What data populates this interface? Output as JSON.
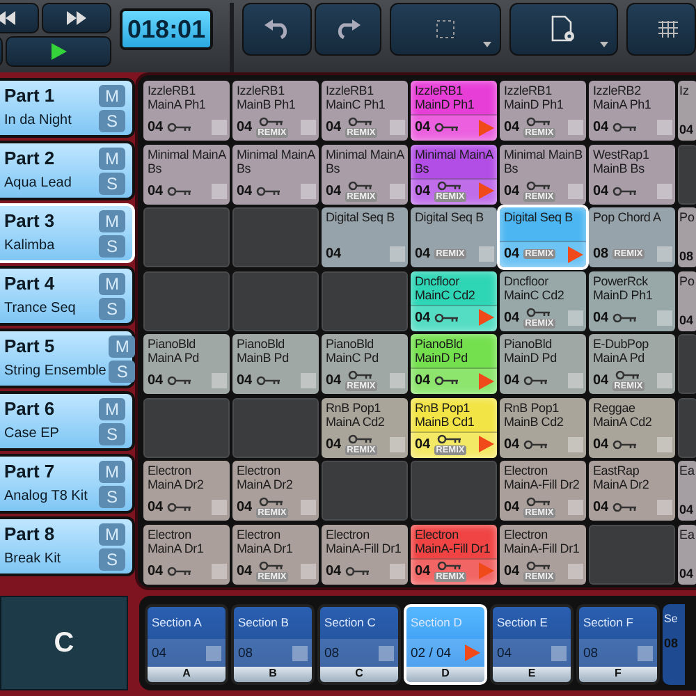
{
  "transport": {
    "time": "018:01"
  },
  "parts": [
    {
      "name": "Part 1",
      "sound": "In da Night",
      "mute": "M",
      "solo": "S",
      "selected": false
    },
    {
      "name": "Part 2",
      "sound": "Aqua Lead",
      "mute": "M",
      "solo": "S",
      "selected": false
    },
    {
      "name": "Part 3",
      "sound": "Kalimba",
      "mute": "M",
      "solo": "S",
      "selected": true
    },
    {
      "name": "Part 4",
      "sound": "Trance Seq",
      "mute": "M",
      "solo": "S",
      "selected": false
    },
    {
      "name": "Part 5",
      "sound": "String Ensemble",
      "mute": "M",
      "solo": "S",
      "selected": false
    },
    {
      "name": "Part 6",
      "sound": "Case EP",
      "mute": "M",
      "solo": "S",
      "selected": false
    },
    {
      "name": "Part 7",
      "sound": "Analog T8 Kit",
      "mute": "M",
      "solo": "S",
      "selected": false
    },
    {
      "name": "Part 8",
      "sound": "Break Kit",
      "mute": "M",
      "solo": "S",
      "selected": false
    }
  ],
  "grid": [
    [
      {
        "kind": "clip",
        "name": "IzzleRB1 MainA Ph1",
        "count": "04",
        "key": true,
        "playing": false,
        "selected": false,
        "color": "#a99ea8"
      },
      {
        "kind": "clip",
        "name": "IzzleRB1 MainB Ph1",
        "count": "04",
        "key": true,
        "badge": "REMIX",
        "playing": false,
        "selected": false,
        "color": "#a99ea8"
      },
      {
        "kind": "clip",
        "name": "IzzleRB1 MainC Ph1",
        "count": "04",
        "key": true,
        "badge": "REMIX",
        "playing": false,
        "selected": false,
        "color": "#a99ea8"
      },
      {
        "kind": "clip",
        "name": "IzzleRB1 MainD Ph1",
        "count": "04",
        "key": true,
        "playing": true,
        "selected": false,
        "color": "#e83ed8"
      },
      {
        "kind": "clip",
        "name": "IzzleRB1 MainD Ph1",
        "count": "04",
        "key": true,
        "badge": "REMIX",
        "playing": false,
        "selected": false,
        "color": "#a99ea8"
      },
      {
        "kind": "clip",
        "name": "IzzleRB2 MainA Ph1",
        "count": "04",
        "key": true,
        "playing": false,
        "selected": false,
        "color": "#a99ea8"
      },
      {
        "kind": "partial",
        "name": "Iz",
        "count": "04"
      }
    ],
    [
      {
        "kind": "clip",
        "name": "Minimal MainA Bs",
        "count": "04",
        "key": true,
        "playing": false,
        "selected": false,
        "color": "#a99ea8"
      },
      {
        "kind": "clip",
        "name": "Minimal MainA Bs",
        "count": "04",
        "key": true,
        "playing": false,
        "selected": false,
        "color": "#a99ea8"
      },
      {
        "kind": "clip",
        "name": "Minimal MainA Bs",
        "count": "04",
        "key": true,
        "badge": "REMIX",
        "playing": false,
        "selected": false,
        "color": "#a99ea8"
      },
      {
        "kind": "clip",
        "name": "Minimal MainA Bs",
        "count": "04",
        "key": true,
        "badge": "REMIX",
        "playing": true,
        "selected": false,
        "color": "#b24ee6"
      },
      {
        "kind": "clip",
        "name": "Minimal MainB Bs",
        "count": "04",
        "key": true,
        "badge": "REMIX",
        "playing": false,
        "selected": false,
        "color": "#a99ea8"
      },
      {
        "kind": "clip",
        "name": "WestRap1 MainB Bs",
        "count": "04",
        "key": true,
        "playing": false,
        "selected": false,
        "color": "#a99ea8"
      },
      {
        "kind": "empty"
      }
    ],
    [
      {
        "kind": "empty"
      },
      {
        "kind": "empty"
      },
      {
        "kind": "clip",
        "name": "Digital Seq B",
        "count": "04",
        "key": false,
        "playing": false,
        "selected": false,
        "color": "#97a3aa"
      },
      {
        "kind": "clip",
        "name": "Digital Seq B",
        "count": "04",
        "key": false,
        "badge": "REMIX",
        "playing": false,
        "selected": false,
        "color": "#97a3aa"
      },
      {
        "kind": "clip",
        "name": "Digital Seq B",
        "count": "04",
        "key": false,
        "badge": "REMIX",
        "playing": true,
        "selected": true,
        "color": "#4cb6f2"
      },
      {
        "kind": "clip",
        "name": "Pop Chord A",
        "count": "08",
        "key": false,
        "badge": "REMIX",
        "playing": false,
        "selected": false,
        "color": "#97a3aa"
      },
      {
        "kind": "partial",
        "name": "Po",
        "count": "08"
      }
    ],
    [
      {
        "kind": "empty"
      },
      {
        "kind": "empty"
      },
      {
        "kind": "empty"
      },
      {
        "kind": "clip",
        "name": "Dncfloor MainC Cd2",
        "count": "04",
        "key": true,
        "playing": true,
        "selected": false,
        "color": "#2fd6b6"
      },
      {
        "kind": "clip",
        "name": "Dncfloor MainC Cd2",
        "count": "04",
        "key": true,
        "badge": "REMIX",
        "playing": false,
        "selected": false,
        "color": "#98a8a8"
      },
      {
        "kind": "clip",
        "name": "PowerRck MainD Ph1",
        "count": "04",
        "key": true,
        "playing": false,
        "selected": false,
        "color": "#98a8a8"
      },
      {
        "kind": "partial",
        "name": "Po",
        "count": "04"
      }
    ],
    [
      {
        "kind": "clip",
        "name": "PianoBld MainA Pd",
        "count": "04",
        "key": true,
        "playing": false,
        "selected": false,
        "color": "#a0a8a5"
      },
      {
        "kind": "clip",
        "name": "PianoBld MainB Pd",
        "count": "04",
        "key": true,
        "playing": false,
        "selected": false,
        "color": "#a0a8a5"
      },
      {
        "kind": "clip",
        "name": "PianoBld MainC Pd",
        "count": "04",
        "key": true,
        "badge": "REMIX",
        "playing": false,
        "selected": false,
        "color": "#a0a8a5"
      },
      {
        "kind": "clip",
        "name": "PianoBld MainD Pd",
        "count": "04",
        "key": true,
        "playing": true,
        "selected": false,
        "color": "#74e04e"
      },
      {
        "kind": "clip",
        "name": "PianoBld MainD Pd",
        "count": "04",
        "key": true,
        "playing": false,
        "selected": false,
        "color": "#a0a8a5"
      },
      {
        "kind": "clip",
        "name": "E-DubPop MainA Pd",
        "count": "04",
        "key": true,
        "badge": "REMIX",
        "playing": false,
        "selected": false,
        "color": "#a0a8a5"
      },
      {
        "kind": "empty"
      }
    ],
    [
      {
        "kind": "empty"
      },
      {
        "kind": "empty"
      },
      {
        "kind": "clip",
        "name": "RnB Pop1 MainA Cd2",
        "count": "04",
        "key": true,
        "badge": "REMIX",
        "playing": false,
        "selected": false,
        "color": "#aaa59b"
      },
      {
        "kind": "clip",
        "name": "RnB Pop1 MainB Cd1",
        "count": "04",
        "key": true,
        "badge": "REMIX",
        "playing": true,
        "selected": false,
        "color": "#f2e444"
      },
      {
        "kind": "clip",
        "name": "RnB Pop1 MainB Cd2",
        "count": "04",
        "key": true,
        "playing": false,
        "selected": false,
        "color": "#aaa59b"
      },
      {
        "kind": "clip",
        "name": "Reggae MainA Cd2",
        "count": "04",
        "key": true,
        "playing": false,
        "selected": false,
        "color": "#aaa59b"
      },
      {
        "kind": "empty"
      }
    ],
    [
      {
        "kind": "clip",
        "name": "Electron MainA Dr2",
        "count": "04",
        "key": true,
        "playing": false,
        "selected": false,
        "color": "#aa9f9b"
      },
      {
        "kind": "clip",
        "name": "Electron MainA Dr2",
        "count": "04",
        "key": true,
        "badge": "REMIX",
        "playing": false,
        "selected": false,
        "color": "#aa9f9b"
      },
      {
        "kind": "empty"
      },
      {
        "kind": "empty"
      },
      {
        "kind": "clip",
        "name": "Electron MainA-Fill Dr2",
        "count": "04",
        "key": true,
        "badge": "REMIX",
        "playing": false,
        "selected": false,
        "color": "#aa9f9b"
      },
      {
        "kind": "clip",
        "name": "EastRap MainA Dr2",
        "count": "04",
        "key": true,
        "playing": false,
        "selected": false,
        "color": "#aa9f9b"
      },
      {
        "kind": "partial",
        "name": "Ea",
        "count": "04"
      }
    ],
    [
      {
        "kind": "clip",
        "name": "Electron MainA Dr1",
        "count": "04",
        "key": true,
        "playing": false,
        "selected": false,
        "color": "#aa9f9b"
      },
      {
        "kind": "clip",
        "name": "Electron MainA Dr1",
        "count": "04",
        "key": true,
        "badge": "REMIX",
        "playing": false,
        "selected": false,
        "color": "#aa9f9b"
      },
      {
        "kind": "clip",
        "name": "Electron MainA-Fill Dr1",
        "count": "04",
        "key": true,
        "playing": false,
        "selected": false,
        "color": "#aa9f9b"
      },
      {
        "kind": "clip",
        "name": "Electron MainA-Fill Dr1",
        "count": "04",
        "key": true,
        "badge": "REMIX",
        "playing": true,
        "selected": false,
        "color": "#f04444"
      },
      {
        "kind": "clip",
        "name": "Electron MainA-Fill Dr1",
        "count": "04",
        "key": true,
        "badge": "REMIX",
        "playing": false,
        "selected": false,
        "color": "#aa9f9b"
      },
      {
        "kind": "empty"
      },
      {
        "kind": "partial",
        "name": "Ea",
        "count": "04"
      }
    ]
  ],
  "chord": "C",
  "sections": [
    {
      "name": "Section A",
      "count": "04",
      "letter": "A",
      "playing": false,
      "selected": false
    },
    {
      "name": "Section B",
      "count": "08",
      "letter": "B",
      "playing": false,
      "selected": false
    },
    {
      "name": "Section C",
      "count": "08",
      "letter": "C",
      "playing": false,
      "selected": false
    },
    {
      "name": "Section D",
      "count": "02 / 04",
      "letter": "D",
      "playing": true,
      "selected": true
    },
    {
      "name": "Section E",
      "count": "04",
      "letter": "E",
      "playing": false,
      "selected": false
    },
    {
      "name": "Section F",
      "count": "08",
      "letter": "F",
      "playing": false,
      "selected": false
    },
    {
      "kind": "partial",
      "name": "Se",
      "count": "08"
    }
  ]
}
